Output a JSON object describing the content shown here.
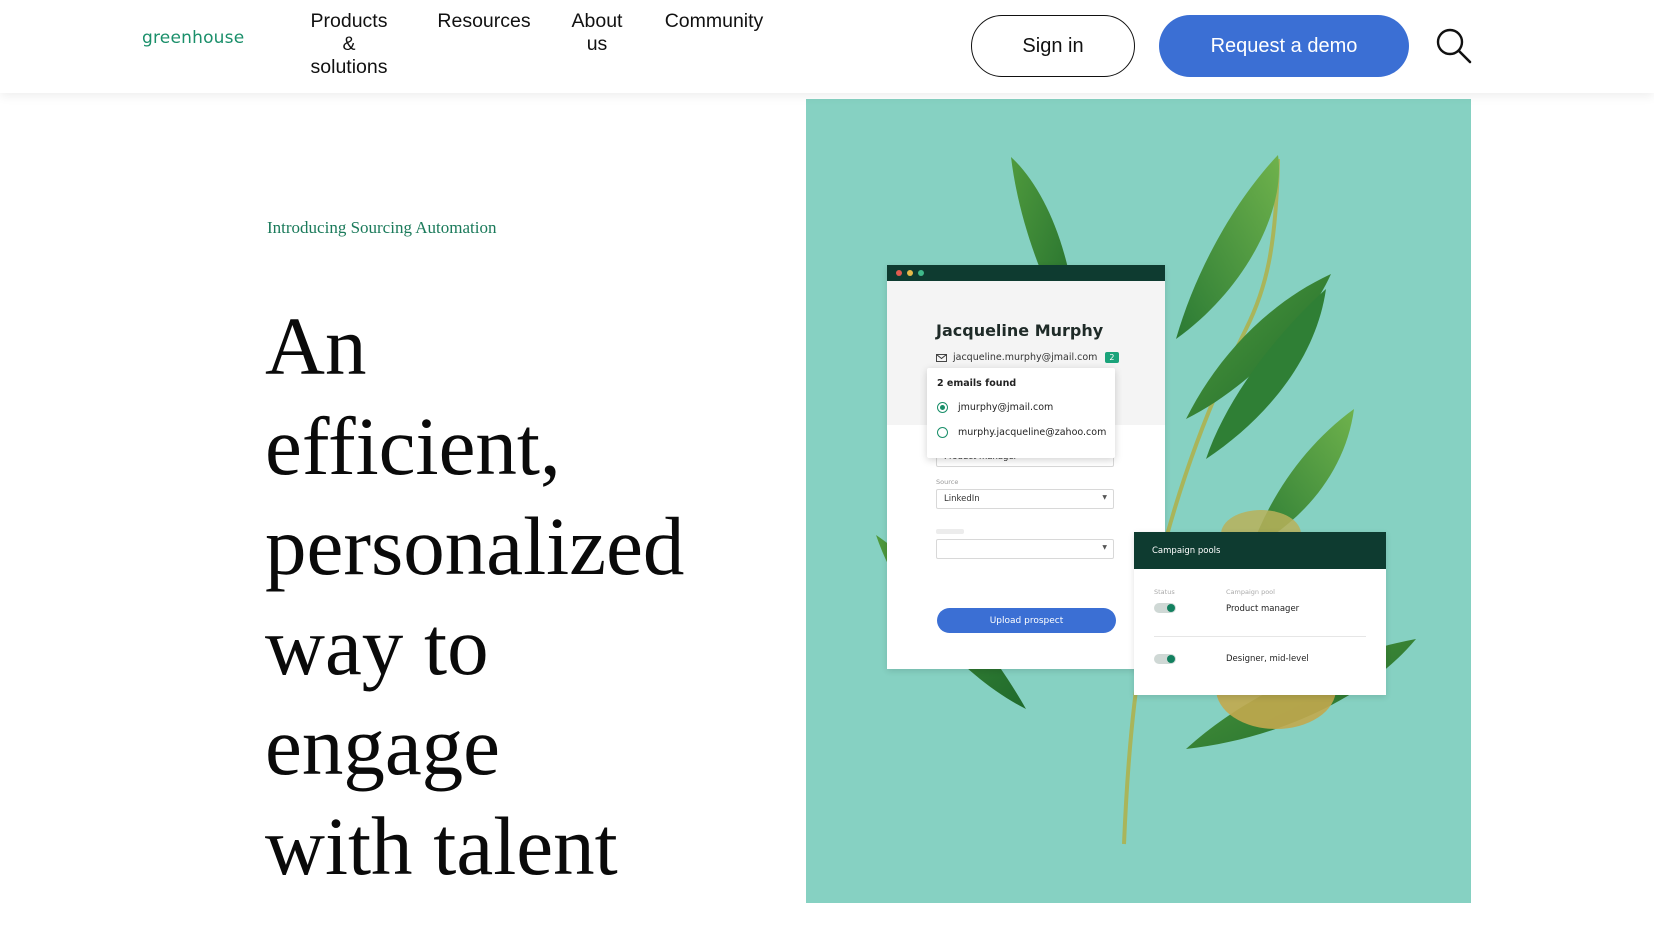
{
  "header": {
    "logo": "greenhouse",
    "nav": {
      "products": [
        "Products",
        "&",
        "solutions"
      ],
      "resources": "Resources",
      "about": [
        "About",
        "us"
      ],
      "community": "Community"
    },
    "signin_label": "Sign in",
    "demo_label": "Request a demo",
    "search_icon": "search-icon"
  },
  "hero": {
    "eyebrow": "Introducing Sourcing Automation",
    "headline_lines": [
      "An",
      "efficient,",
      "personalized",
      "way to",
      "engage",
      "with talent"
    ]
  },
  "mock_profile": {
    "name": "Jacqueline Murphy",
    "email": "jacqueline.murphy@jmail.com",
    "email_count": "2",
    "popover_title": "2 emails found",
    "options": [
      "jmurphy@jmail.com",
      "murphy.jacqueline@zahoo.com"
    ],
    "selected_index": 0,
    "job_value": "Product manager",
    "source_label": "Source",
    "source_value": "LinkedIn",
    "upload_label": "Upload prospect"
  },
  "mock_campaign": {
    "title": "Campaign pools",
    "col_status": "Status",
    "col_pool": "Campaign pool",
    "rows": [
      "Product manager",
      "Designer, mid-level"
    ]
  },
  "colors": {
    "brand_green": "#1a8f6a",
    "button_blue": "#3b6fd4",
    "hero_bg": "#86d1c2",
    "dark_green": "#0e3b30"
  }
}
